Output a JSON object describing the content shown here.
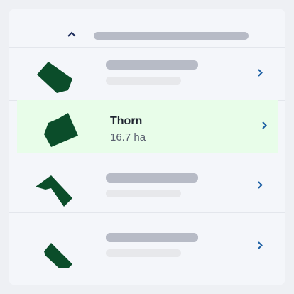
{
  "header": {
    "collapse_icon": "chevron-up-icon"
  },
  "fields": [
    {
      "placeholder": true,
      "icon": "chevron-right-icon"
    },
    {
      "name": "Thorn",
      "area": "16.7 ha",
      "selected": true,
      "icon": "chevron-right-icon"
    },
    {
      "placeholder": true,
      "icon": "chevron-right-icon"
    },
    {
      "placeholder": true,
      "icon": "chevron-right-icon"
    }
  ],
  "colors": {
    "accent": "#1c5fa3",
    "field_shape": "#0b4d2a",
    "selected_bg": "#e8fde9",
    "skeleton_dark": "#b7bbc6",
    "skeleton_light": "#e7e8eb"
  }
}
